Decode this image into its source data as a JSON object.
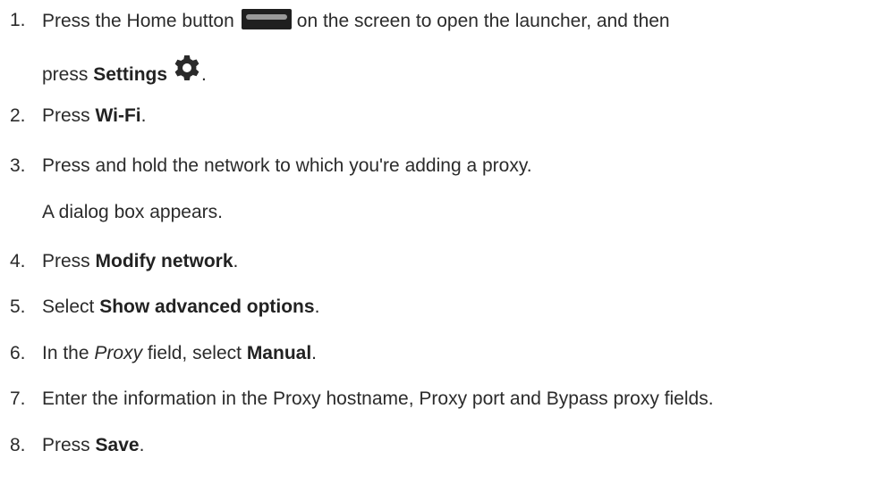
{
  "steps": [
    {
      "num": "1.",
      "pre": "Press the Home button",
      "post": "on the screen to open the launcher, and then",
      "line2_pre": "press ",
      "line2_bold": "Settings",
      "line2_post": ".",
      "icons": [
        "home-button-icon",
        "gear-icon"
      ]
    },
    {
      "num": "2.",
      "pre": "Press ",
      "bold": "Wi-Fi",
      "post": "."
    },
    {
      "num": "3.",
      "text": "Press and hold the network to which you're adding a proxy.",
      "note": "A dialog box appears."
    },
    {
      "num": "4.",
      "pre": "Press ",
      "bold": "Modify network",
      "post": "."
    },
    {
      "num": "5.",
      "pre": "Select ",
      "bold": "Show advanced options",
      "post": "."
    },
    {
      "num": "6.",
      "pre": "In the ",
      "italic": "Proxy",
      "mid": " field, select ",
      "bold": "Manual",
      "post": "."
    },
    {
      "num": "7.",
      "text": "Enter the information in the Proxy hostname, Proxy port and Bypass proxy fields."
    },
    {
      "num": "8.",
      "pre": "Press ",
      "bold": "Save",
      "post": "."
    }
  ]
}
